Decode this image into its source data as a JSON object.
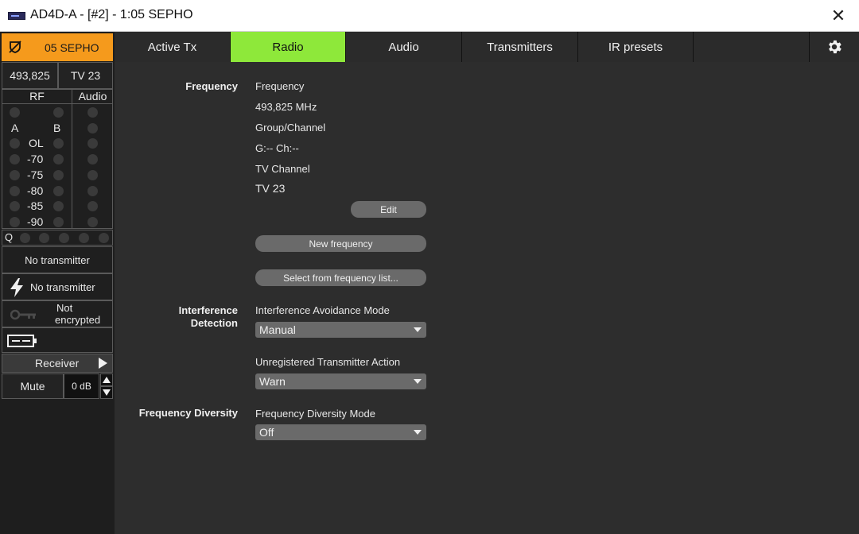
{
  "window": {
    "title": "AD4D-A - [#2] - 1:05 SEPHO",
    "close_symbol": "✕",
    "app_icon": "receiver-device-icon"
  },
  "sidebar": {
    "channel_name": "05 SEPHO",
    "header_color": "#f59a1c",
    "frequency": "493,825",
    "tv_channel": "TV 23",
    "rf_label": "RF",
    "audio_label": "Audio",
    "antenna_a": "A",
    "antenna_b": "B",
    "rf_scale": [
      "OL",
      "-70",
      "-75",
      "-80",
      "-85",
      "-90"
    ],
    "quality_label": "Q",
    "tx_status": "No transmitter",
    "battery_status": "No transmitter",
    "encryption_line1": "Not",
    "encryption_line2": "encrypted",
    "receiver_label": "Receiver",
    "mute_label": "Mute",
    "gain_value": "0 dB"
  },
  "tabs": [
    {
      "label": "Active Tx",
      "active": false
    },
    {
      "label": "Radio",
      "active": true
    },
    {
      "label": "Audio",
      "active": false
    },
    {
      "label": "Transmitters",
      "active": false
    },
    {
      "label": "IR presets",
      "active": false
    }
  ],
  "accent_color": "#8ee83a",
  "radio": {
    "frequency_section": "Frequency",
    "frequency_label": "Frequency",
    "frequency_value": "493,825 MHz",
    "group_channel_label": "Group/Channel",
    "group_channel_value": "G:-- Ch:--",
    "tv_channel_label": "TV Channel",
    "tv_channel_value": "TV 23",
    "edit_button": "Edit",
    "new_frequency_button": "New frequency",
    "select_list_button": "Select from frequency list...",
    "interference_section_line1": "Interference",
    "interference_section_line2": "Detection",
    "avoidance_mode_label": "Interference Avoidance Mode",
    "avoidance_mode_value": "Manual",
    "unregistered_action_label": "Unregistered Transmitter Action",
    "unregistered_action_value": "Warn",
    "diversity_section": "Frequency Diversity",
    "diversity_mode_label": "Frequency Diversity Mode",
    "diversity_mode_value": "Off"
  }
}
